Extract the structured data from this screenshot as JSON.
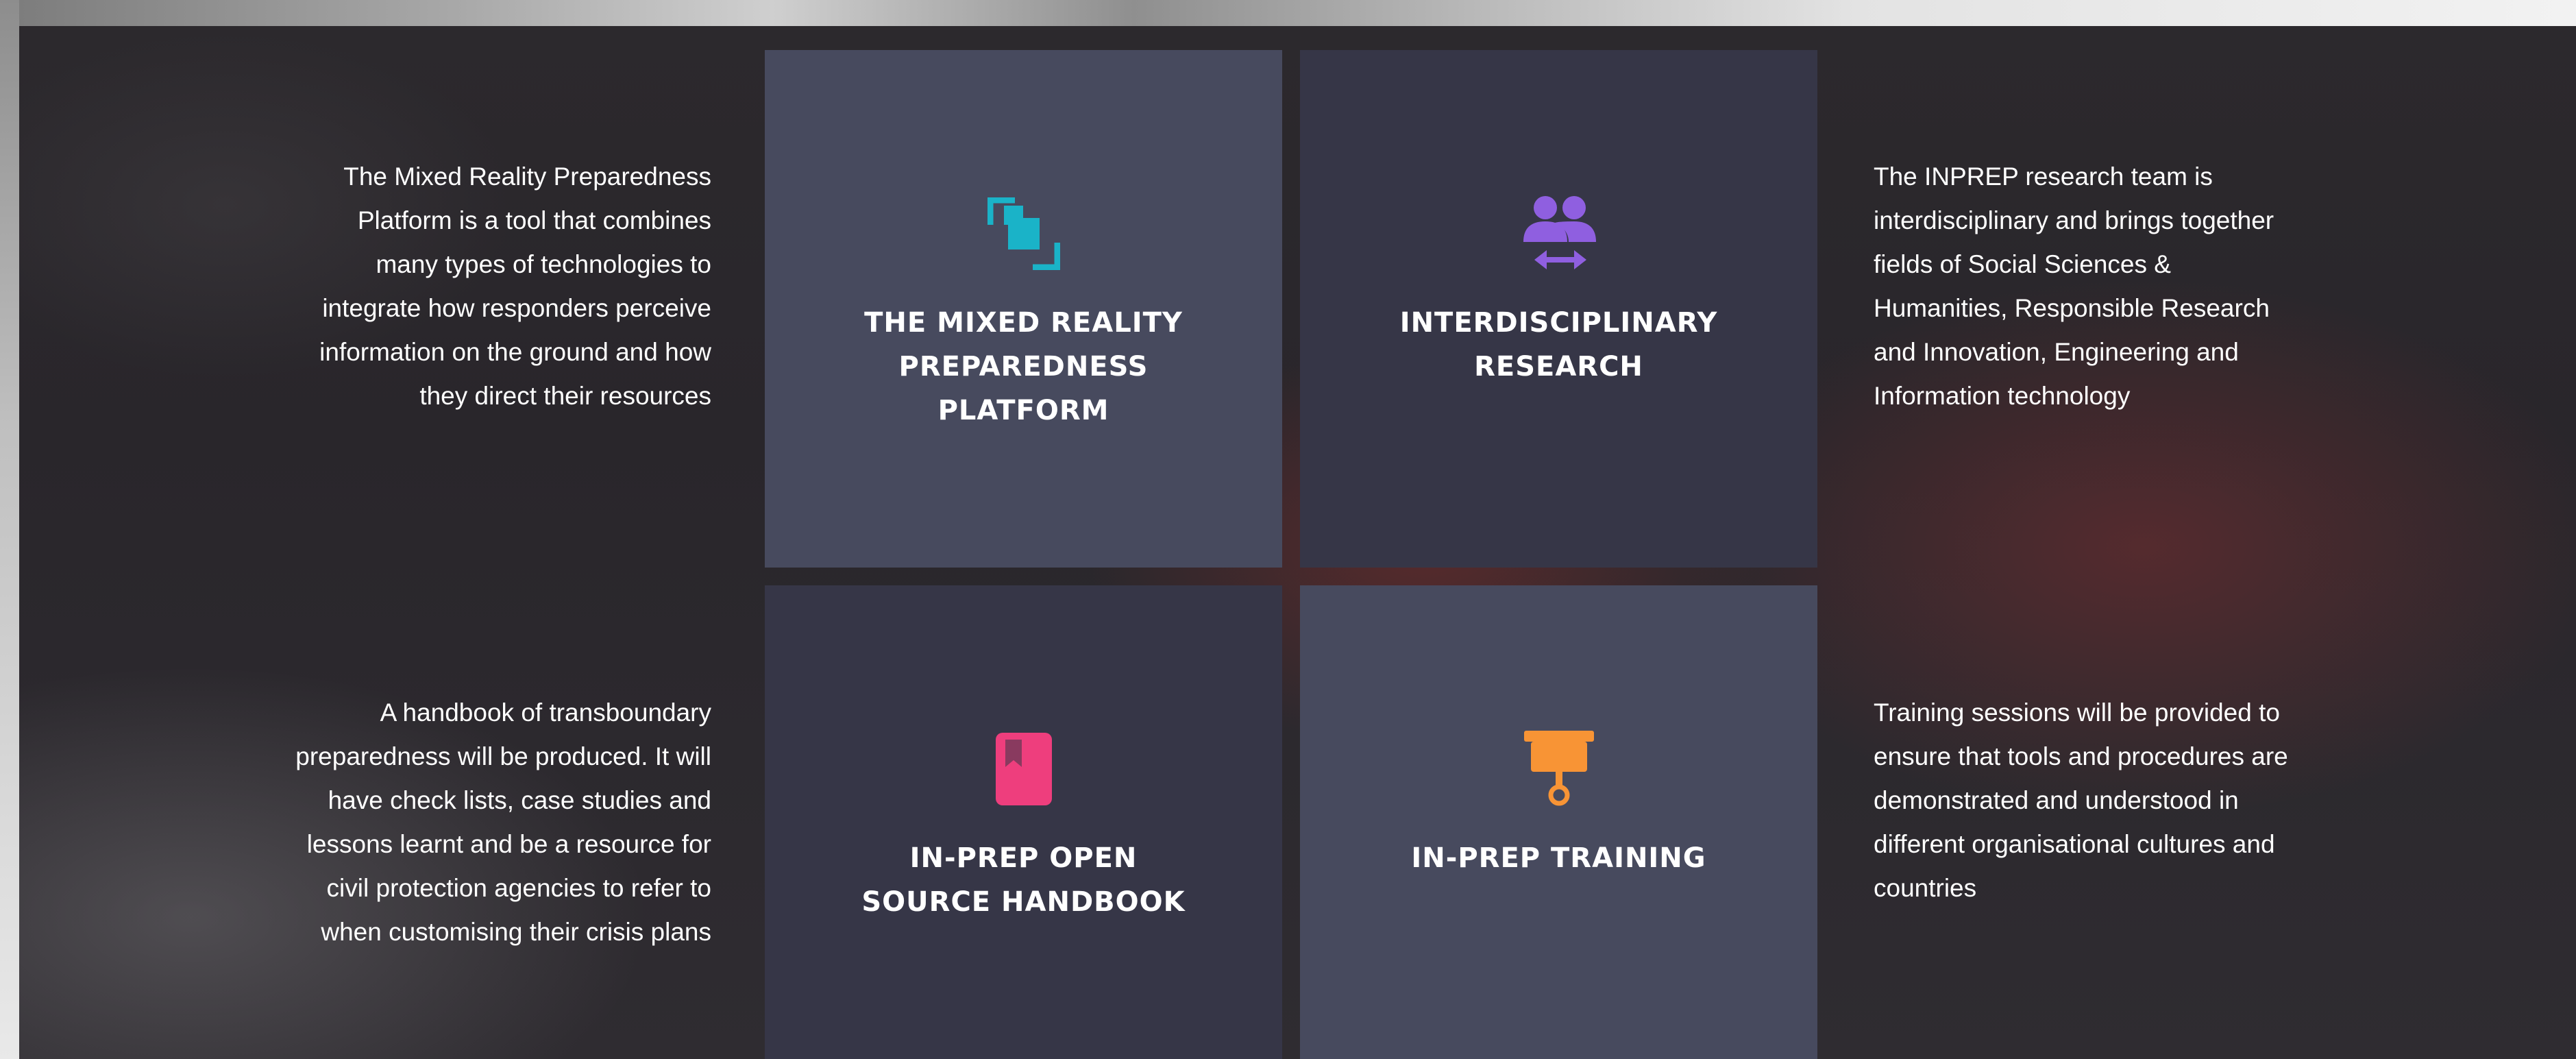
{
  "features": [
    {
      "title_lines": [
        "The Mixed Reality",
        "Preparedness",
        "Platform"
      ],
      "icon": "mixed-reality-icon",
      "icon_color": "#1ab3c8",
      "description_lines": [
        "The Mixed Reality Preparedness",
        "Platform is a tool that combines",
        "many types of technologies to",
        "integrate how responders perceive",
        "information on the ground and how",
        "they direct their resources"
      ]
    },
    {
      "title_lines": [
        "Interdisciplinary",
        "Research"
      ],
      "icon": "people-exchange-icon",
      "icon_color": "#8f5fe0",
      "description_lines": [
        "The INPREP research team is",
        "interdisciplinary and brings together",
        "fields of Social Sciences &",
        "Humanities, Responsible Research",
        "and Innovation, Engineering and",
        "Information technology"
      ]
    },
    {
      "title_lines": [
        "IN-PREP Open",
        "Source Handbook"
      ],
      "icon": "handbook-icon",
      "icon_color": "#ee3e7d",
      "description_lines": [
        "A handbook of transboundary",
        "preparedness will be produced. It will",
        "have check lists, case studies and",
        "lessons learnt and be a resource for",
        "civil protection agencies to refer to",
        "when customising their crisis plans"
      ]
    },
    {
      "title_lines": [
        "IN-PREP Training"
      ],
      "icon": "training-board-icon",
      "icon_color": "#f89435",
      "description_lines": [
        "Training sessions will be provided to",
        "ensure that tools and procedures are",
        "demonstrated and understood in",
        "different organisational cultures and",
        "countries"
      ]
    }
  ]
}
